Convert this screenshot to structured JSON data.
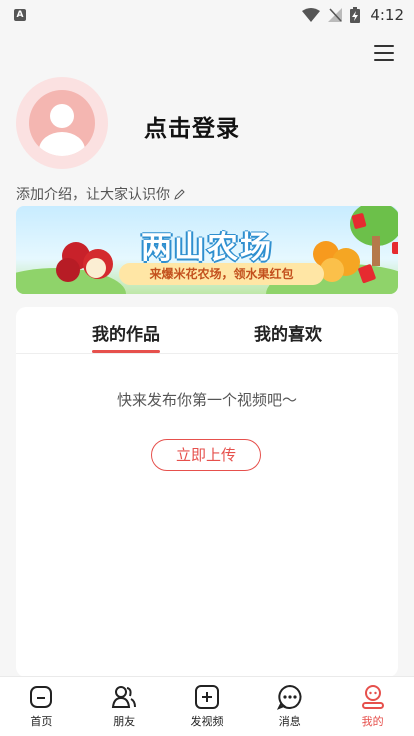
{
  "status_bar": {
    "time": "4:12",
    "app_badge": "A"
  },
  "profile": {
    "login_text": "点击登录",
    "intro_text": "添加介绍，让大家认识你"
  },
  "banner": {
    "title": "两山农场",
    "subtitle": "来爆米花农场，领水果红包"
  },
  "tabs": [
    {
      "label": "我的作品",
      "active": true
    },
    {
      "label": "我的喜欢",
      "active": false
    }
  ],
  "empty_state": {
    "message": "快来发布你第一个视频吧～",
    "button_label": "立即上传"
  },
  "bottom_nav": [
    {
      "label": "首页",
      "icon": "home-icon"
    },
    {
      "label": "朋友",
      "icon": "friends-icon"
    },
    {
      "label": "发视频",
      "icon": "add-video-icon"
    },
    {
      "label": "消息",
      "icon": "message-icon"
    },
    {
      "label": "我的",
      "icon": "profile-icon",
      "active": true
    }
  ],
  "colors": {
    "accent": "#e6504c",
    "avatar_bg": "#fbe1e1"
  }
}
